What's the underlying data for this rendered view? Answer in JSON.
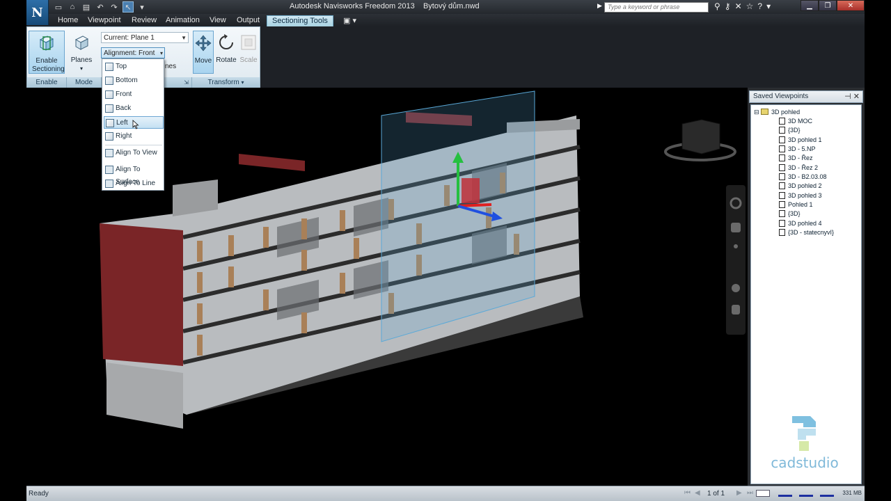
{
  "window": {
    "title": "Autodesk Navisworks Freedom 2013    Bytový dům.nwd",
    "app_button_glyph": "N",
    "search_placeholder": "Type a keyword or phrase"
  },
  "tabs": [
    "Home",
    "Viewpoint",
    "Review",
    "Animation",
    "View",
    "Output",
    "Sectioning Tools"
  ],
  "active_tab": "Sectioning Tools",
  "ribbon": {
    "enable_label": "Enable Sectioning",
    "planes_label": "Planes",
    "current_plane": "Current: Plane 1",
    "alignment": "Alignment: Front",
    "link_planes_partial": "nes",
    "move_label": "Move",
    "rotate_label": "Rotate",
    "scale_label": "Scale",
    "panels": {
      "enable": "Enable",
      "mode": "Mode",
      "transform": "Transform"
    }
  },
  "alignment_menu": {
    "items": [
      "Top",
      "Bottom",
      "Front",
      "Back",
      "Left",
      "Right"
    ],
    "highlighted": "Left",
    "extra_items": [
      "Align To View",
      "Align To Surface",
      "Align To Line"
    ]
  },
  "saved_viewpoints": {
    "title": "Saved Viewpoints",
    "root": "3D pohled",
    "items": [
      "3D MOC",
      "{3D}",
      "3D pohled 1",
      "3D - 5.NP",
      "3D - Řez",
      "3D - Řez 2",
      "3D - B2.03.08",
      "3D pohled 2",
      "3D pohled 3",
      "Pohled 1",
      "{3D}",
      "3D pohled 4",
      "{3D - statecnyvI}"
    ]
  },
  "watermark": "cadstudio",
  "status": {
    "ready": "Ready",
    "page": "1 of 1",
    "memory": "331 MB"
  },
  "colors": {
    "accent": "#a9d3e3",
    "viewport_bg": "#000000",
    "brick_red": "#7a2527",
    "section_plane": "#5aa9d8"
  }
}
